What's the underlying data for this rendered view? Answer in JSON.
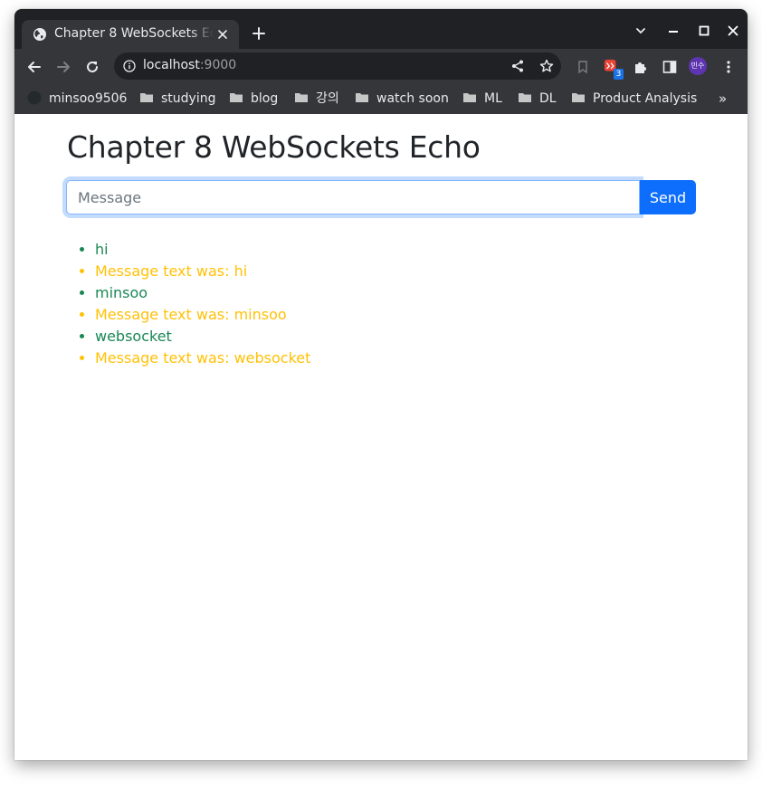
{
  "browser": {
    "tab_title": "Chapter 8 WebSockets Echo",
    "url_host": "localhost",
    "url_port": ":9000",
    "extension_badge": "3",
    "profile_initials": "민수",
    "bookmarks": [
      {
        "label": "minsoo9506",
        "icon": "github-icon"
      },
      {
        "label": "studying",
        "icon": "folder-icon"
      },
      {
        "label": "blog",
        "icon": "folder-icon"
      },
      {
        "label": "강의",
        "icon": "folder-icon"
      },
      {
        "label": "watch soon",
        "icon": "folder-icon"
      },
      {
        "label": "ML",
        "icon": "folder-icon"
      },
      {
        "label": "DL",
        "icon": "folder-icon"
      },
      {
        "label": "Product Analysis",
        "icon": "folder-icon"
      }
    ],
    "bookmarks_overflow": "»",
    "colors": {
      "frame": "#202124",
      "toolbar": "#35363a",
      "text": "#e8eaed"
    }
  },
  "page": {
    "heading": "Chapter 8 WebSockets Echo",
    "input_placeholder": "Message",
    "input_value": "",
    "send_label": "Send",
    "messages": [
      {
        "kind": "sent",
        "text": "hi"
      },
      {
        "kind": "echo",
        "text": "Message text was: hi"
      },
      {
        "kind": "sent",
        "text": "minsoo"
      },
      {
        "kind": "echo",
        "text": "Message text was: minsoo"
      },
      {
        "kind": "sent",
        "text": "websocket"
      },
      {
        "kind": "echo",
        "text": "Message text was: websocket"
      }
    ],
    "colors": {
      "sent": "#198754",
      "echo": "#ffc107",
      "primary": "#0d6efd"
    }
  }
}
